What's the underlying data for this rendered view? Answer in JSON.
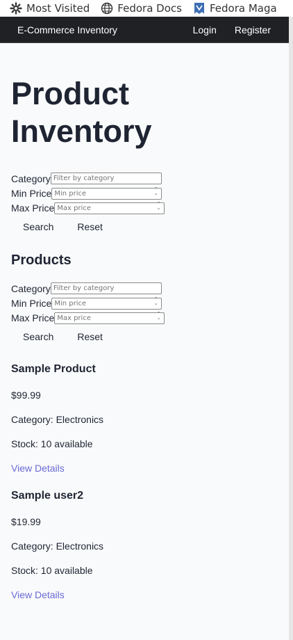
{
  "bookmarks": [
    {
      "icon": "gear-icon",
      "label": "Most Visited"
    },
    {
      "icon": "globe-icon",
      "label": "Fedora Docs"
    },
    {
      "icon": "fedora-magazine-icon",
      "label": "Fedora Maga"
    }
  ],
  "navbar": {
    "brand": "E-Commerce Inventory",
    "login": "Login",
    "register": "Register"
  },
  "page_title": "Product Inventory",
  "filters_top": {
    "category_label": "Category",
    "category_placeholder": "Filter by category",
    "min_label": "Min Price",
    "min_placeholder": "Min price",
    "max_label": "Max Price",
    "max_placeholder": "Max price",
    "search": "Search",
    "reset": "Reset"
  },
  "products_heading": "Products",
  "filters_products": {
    "category_label": "Category",
    "category_placeholder": "Filter by category",
    "min_label": "Min Price",
    "min_placeholder": "Min price",
    "max_label": "Max Price",
    "max_placeholder": "Max price",
    "search": "Search",
    "reset": "Reset"
  },
  "products": [
    {
      "name": "Sample Product",
      "price": "$99.99",
      "category": "Category: Electronics",
      "stock": "Stock: 10 available",
      "link": "View Details"
    },
    {
      "name": "Sample user2",
      "price": "$19.99",
      "category": "Category: Electronics",
      "stock": "Stock: 10 available",
      "link": "View Details"
    }
  ],
  "colors": {
    "navbar_bg": "#1f2124",
    "link": "#6a6ad6",
    "page_bg": "#f9fafb"
  }
}
